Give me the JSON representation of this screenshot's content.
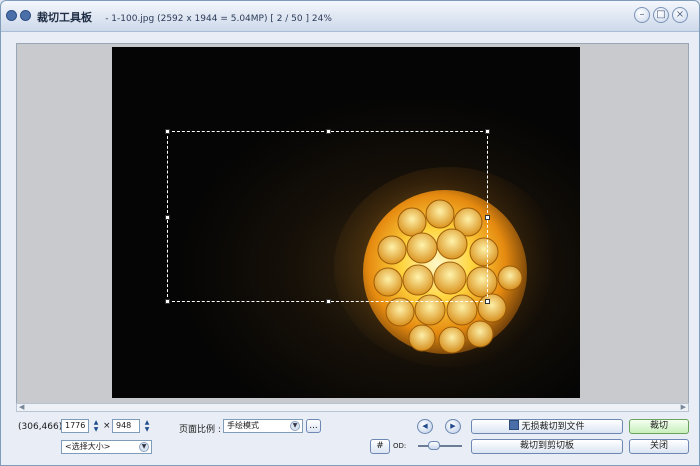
{
  "window": {
    "app_title": "裁切工具板",
    "info": "- 1-100.jpg  (2592 x 1944 = 5.04MP)  [ 2 / 50 ]   24%",
    "controls": {
      "min": "–",
      "max": "□",
      "close": "×"
    }
  },
  "bottom": {
    "coords": "(306,466)",
    "width": "1776",
    "times": "×",
    "height": "948",
    "size_select": "<选择大小>",
    "ratio_label": "页面比例 :",
    "ratio_value": "手绘模式",
    "ratio_more": "...",
    "lossless_save": "无损裁切到文件",
    "crop": "裁切",
    "crop_to_clipboard": "裁切到剪切板",
    "close": "关闭",
    "grid_btn": "#",
    "od_label": "OD:"
  },
  "icons": [
    "window-menu-icon",
    "window-pin-icon",
    "minimize-icon",
    "maximize-icon",
    "close-icon",
    "prev-icon",
    "next-icon",
    "save-icon"
  ],
  "colors": {
    "accent": "#7f9db9",
    "green_button": "#c8efbc"
  }
}
